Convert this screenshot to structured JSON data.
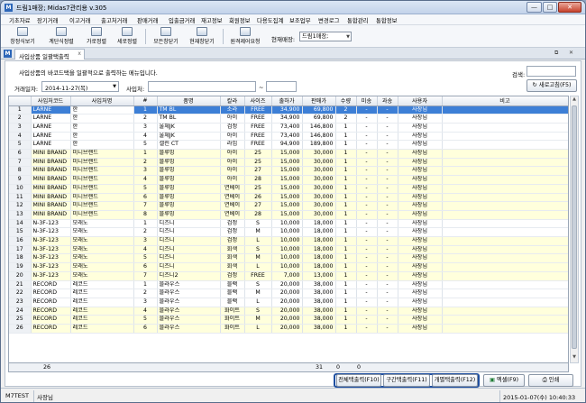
{
  "window": {
    "title": "드림1매장; Midas7관리용 v.305",
    "min": "—",
    "max": "□",
    "close": "✕"
  },
  "menu": [
    "기초자료",
    "장기거래",
    "이고거래",
    "출고처거래",
    "판매거래",
    "입출금거래",
    "재고정보",
    "회원정보",
    "다용도집계",
    "보조업무",
    "변경로그",
    "통합관리",
    "통합정보"
  ],
  "toolbar": {
    "buttons": [
      "창정식보기",
      "계단식정렬",
      "가로정렬",
      "세로정렬",
      "모든창닫기",
      "현재창닫기",
      "원격제어요청"
    ],
    "store_label": "현재매장:",
    "store_value": "드림1매장;"
  },
  "tab": {
    "label": "사입상품 일괄택출력",
    "close": "x"
  },
  "form": {
    "description": "사입상품의 바코드택을 일괄적으로 출력하는 메뉴입니다.",
    "date_label": "거래일자:",
    "date_value": "2014-11-27(목)",
    "supplier_label": "사입처:",
    "search_label": "검색:",
    "refresh_label": "새로고침(F5)",
    "range_sep": "~"
  },
  "columns": [
    "",
    "사입처코드",
    "사입처명",
    "#",
    "품명",
    "칼라",
    "사이즈",
    "출하가",
    "판매가",
    "수량",
    "미송",
    "과송",
    "사용자",
    "비고"
  ],
  "rows": [
    [
      "1",
      "LARNE",
      "한",
      "1",
      "TM BL",
      "소라",
      "FREE",
      "34,900",
      "69,800",
      "2",
      "-",
      "-",
      "사장님",
      ""
    ],
    [
      "2",
      "LARNE",
      "한",
      "2",
      "TM BL",
      "아이",
      "FREE",
      "34,900",
      "69,800",
      "2",
      "-",
      "-",
      "사장님",
      ""
    ],
    [
      "3",
      "LARNE",
      "한",
      "3",
      "울체JK",
      "검정",
      "FREE",
      "73,400",
      "146,800",
      "1",
      "-",
      "-",
      "사장님",
      ""
    ],
    [
      "4",
      "LARNE",
      "한",
      "4",
      "울체JK",
      "아이",
      "FREE",
      "73,400",
      "146,800",
      "1",
      "-",
      "-",
      "사장님",
      ""
    ],
    [
      "5",
      "LARNE",
      "한",
      "5",
      "셀린 CT",
      "라임",
      "FREE",
      "94,900",
      "189,800",
      "1",
      "-",
      "-",
      "사장님",
      ""
    ],
    [
      "6",
      "MINI BRAND",
      "미니브랜드",
      "1",
      "블루밍",
      "아이",
      "25",
      "15,000",
      "30,000",
      "1",
      "-",
      "-",
      "사장님",
      ""
    ],
    [
      "7",
      "MINI BRAND",
      "미니브랜드",
      "2",
      "블루밍",
      "아이",
      "25",
      "15,000",
      "30,000",
      "1",
      "-",
      "-",
      "사장님",
      ""
    ],
    [
      "8",
      "MINI BRAND",
      "미니브랜드",
      "3",
      "블루밍",
      "아이",
      "27",
      "15,000",
      "30,000",
      "1",
      "-",
      "-",
      "사장님",
      ""
    ],
    [
      "9",
      "MINI BRAND",
      "미니브랜드",
      "4",
      "블루밍",
      "아이",
      "28",
      "15,000",
      "30,000",
      "1",
      "-",
      "-",
      "사장님",
      ""
    ],
    [
      "10",
      "MINI BRAND",
      "미니브랜드",
      "5",
      "블루밍",
      "연베이",
      "25",
      "15,000",
      "30,000",
      "1",
      "-",
      "-",
      "사장님",
      ""
    ],
    [
      "11",
      "MINI BRAND",
      "미니브랜드",
      "6",
      "블루밍",
      "연베이",
      "26",
      "15,000",
      "30,000",
      "1",
      "-",
      "-",
      "사장님",
      ""
    ],
    [
      "12",
      "MINI BRAND",
      "미니브랜드",
      "7",
      "블루밍",
      "연베이",
      "27",
      "15,000",
      "30,000",
      "1",
      "-",
      "-",
      "사장님",
      ""
    ],
    [
      "13",
      "MINI BRAND",
      "미니브랜드",
      "8",
      "블루밍",
      "연베이",
      "28",
      "15,000",
      "30,000",
      "1",
      "-",
      "-",
      "사장님",
      ""
    ],
    [
      "14",
      "N-3F-123",
      "모래노",
      "1",
      "디즈니",
      "검정",
      "S",
      "10,000",
      "18,000",
      "1",
      "-",
      "-",
      "사장님",
      ""
    ],
    [
      "15",
      "N-3F-123",
      "모래노",
      "2",
      "디즈니",
      "검정",
      "M",
      "10,000",
      "18,000",
      "1",
      "-",
      "-",
      "사장님",
      ""
    ],
    [
      "16",
      "N-3F-123",
      "모래노",
      "3",
      "디즈니",
      "검정",
      "L",
      "10,000",
      "18,000",
      "1",
      "-",
      "-",
      "사장님",
      ""
    ],
    [
      "17",
      "N-3F-123",
      "모래노",
      "4",
      "디즈니",
      "회색",
      "S",
      "10,000",
      "18,000",
      "1",
      "-",
      "-",
      "사장님",
      ""
    ],
    [
      "18",
      "N-3F-123",
      "모래노",
      "5",
      "디즈니",
      "회색",
      "M",
      "10,000",
      "18,000",
      "1",
      "-",
      "-",
      "사장님",
      ""
    ],
    [
      "19",
      "N-3F-123",
      "모래노",
      "6",
      "디즈니",
      "회색",
      "L",
      "10,000",
      "18,000",
      "1",
      "-",
      "-",
      "사장님",
      ""
    ],
    [
      "20",
      "N-3F-123",
      "모래노",
      "7",
      "디즈니2",
      "검정",
      "FREE",
      "7,000",
      "13,000",
      "1",
      "-",
      "-",
      "사장님",
      ""
    ],
    [
      "21",
      "RECORD",
      "레코드",
      "1",
      "블라우스",
      "블랙",
      "S",
      "20,000",
      "38,000",
      "1",
      "-",
      "-",
      "사장님",
      ""
    ],
    [
      "22",
      "RECORD",
      "레코드",
      "2",
      "블라우스",
      "블랙",
      "M",
      "20,000",
      "38,000",
      "1",
      "-",
      "-",
      "사장님",
      ""
    ],
    [
      "23",
      "RECORD",
      "레코드",
      "3",
      "블라우스",
      "블랙",
      "L",
      "20,000",
      "38,000",
      "1",
      "-",
      "-",
      "사장님",
      ""
    ],
    [
      "24",
      "RECORD",
      "레코드",
      "4",
      "블라우스",
      "화이트",
      "S",
      "20,000",
      "38,000",
      "1",
      "-",
      "-",
      "사장님",
      ""
    ],
    [
      "25",
      "RECORD",
      "레코드",
      "5",
      "블라우스",
      "화이트",
      "M",
      "20,000",
      "38,000",
      "1",
      "-",
      "-",
      "사장님",
      ""
    ],
    [
      "26",
      "RECORD",
      "레코드",
      "6",
      "블라우스",
      "화이트",
      "L",
      "20,000",
      "38,000",
      "1",
      "-",
      "-",
      "사장님",
      ""
    ]
  ],
  "totals": {
    "count": "26",
    "qty": "31",
    "miss": "0",
    "over": "0"
  },
  "buttons": {
    "print_all": "전체택출력(F10)",
    "print_range": "구간택출력(F11)",
    "print_each": "개별택출력(F12)",
    "excel": "엑셀(F9)",
    "print": "인쇄"
  },
  "status": {
    "user": "M7TEST",
    "role": "사장님",
    "datetime": "2015-01-07(수) 10:40:33"
  },
  "colors": {
    "selected_row": "#3d7fd6",
    "yellow_row": "#ffffdc",
    "accent": "#1f4fa0"
  }
}
